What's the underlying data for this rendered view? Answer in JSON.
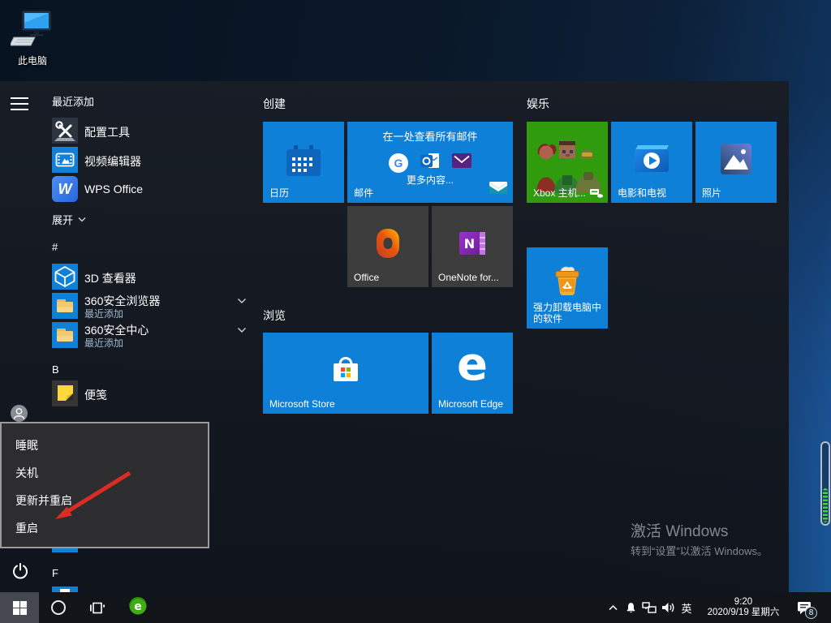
{
  "desktop": {
    "this_pc_label": "此电脑",
    "activation": {
      "title": "激活 Windows",
      "subtitle": "转到“设置”以激活 Windows。"
    }
  },
  "start": {
    "recent_header": "最近添加",
    "expand_label": "展开",
    "recent_apps": [
      {
        "label": "配置工具"
      },
      {
        "label": "视频编辑器"
      },
      {
        "label": "WPS Office"
      }
    ],
    "sections": {
      "hash": "#",
      "b": "B",
      "f": "F"
    },
    "apps": [
      {
        "label": "3D 查看器"
      },
      {
        "label": "360安全浏览器",
        "sub": "最近添加"
      },
      {
        "label": "360安全中心",
        "sub": "最近添加"
      },
      {
        "label": "便笺"
      }
    ],
    "groups": {
      "create": "创建",
      "browse": "浏览",
      "fun": "娱乐"
    },
    "tiles": {
      "calendar": "日历",
      "mail": "邮件",
      "mail_promo_title": "在一处查看所有邮件",
      "mail_promo_more": "更多内容...",
      "office": "Office",
      "onenote": "OneNote for...",
      "store": "Microsoft Store",
      "edge": "Microsoft Edge",
      "edge_letter": "e",
      "xbox": "Xbox 主机...",
      "movies": "电影和电视",
      "photos": "照片",
      "uninstall": "强力卸载电脑中的软件",
      "wps_letter": "W",
      "google_letter": "G",
      "onenote_letter": "N"
    },
    "power_menu": [
      "睡眠",
      "关机",
      "更新并重启",
      "重启"
    ]
  },
  "taskbar": {
    "lang": "英",
    "time": "9:20",
    "date": "2020/9/19 星期六",
    "badge": "8"
  },
  "colors": {
    "tile_blue": "#0f80d8",
    "tile_dark": "#3c3c3c",
    "xbox_green": "#2f9b0d",
    "arrow_red": "#d92c22"
  }
}
